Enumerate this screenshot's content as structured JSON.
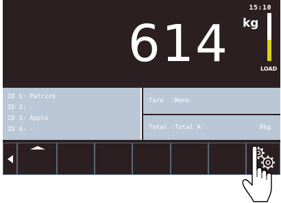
{
  "status_bar": {
    "time": "15:10"
  },
  "scale": {
    "weight": "614",
    "unit": "kg",
    "load_label": "LOAD",
    "load_fraction": 0.45
  },
  "ids": [
    {
      "label": "ID 1: Patrick"
    },
    {
      "label": "ID 2: -"
    },
    {
      "label": "ID 3: Apple"
    },
    {
      "label": "ID 4: -"
    }
  ],
  "tare": {
    "text": "Tare  :None"
  },
  "total": {
    "text": "Total :Total A",
    "value": "0kg"
  },
  "softkeys": {
    "back_icon": "triangle-left-icon",
    "up_icon": "triangle-up-icon",
    "settings_icon": "gears-icon"
  },
  "colors": {
    "screen_bg": "#2c1f22",
    "panel_bg": "#b9c7d6",
    "load_fill": "#d9d31a",
    "button_border": "#596a78"
  }
}
